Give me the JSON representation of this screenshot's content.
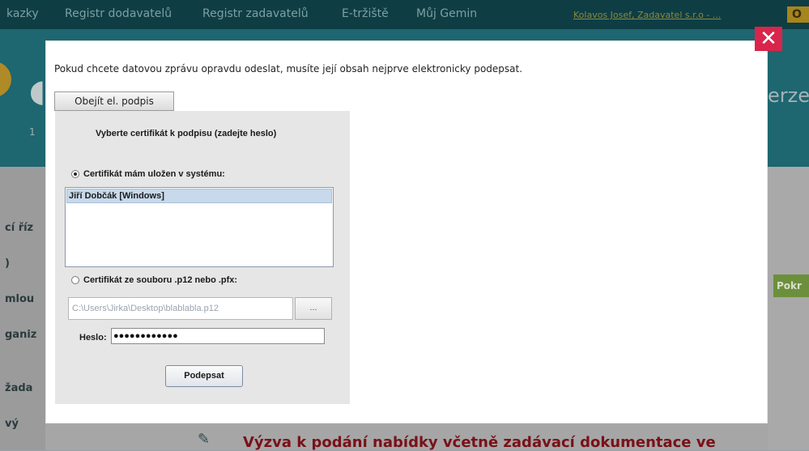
{
  "background": {
    "nav_items": [
      "kazky",
      "Registr dodavatelů",
      "Registr zadavatelů",
      "E-tržiště",
      "Můj Gemin"
    ],
    "user_link": "Kolavos Josef, Zadavatel s.r.o - ...",
    "nav_button": "O",
    "header_number": "1",
    "header_title_right": "erze",
    "left_menu": [
      "cí říz",
      ")",
      "mlou",
      "ganiz",
      "žada",
      "vý"
    ],
    "continue_button": "Pokr",
    "bottom_title": "Výzva k podání nabídky včetně zadávací dokumentace ve"
  },
  "modal": {
    "close_label": "✕",
    "message": "Pokud chcete datovou zprávu opravdu odeslat, musíte její obsah nejprve elektronicky podepsat.",
    "bypass_button": "Obejít el. podpis",
    "applet": {
      "title": "Vyberte certifikát k podpisu (zadejte heslo)",
      "option_system_label": "Certifikát mám uložen v systému:",
      "certificates": [
        "Jiří Dobčák [Windows]"
      ],
      "option_file_label": "Certifikát ze souboru .p12 nebo .pfx:",
      "file_path": "C:\\Users\\Jirka\\Desktop\\blablabla.p12",
      "browse_label": "...",
      "password_label": "Heslo:",
      "password_value": "●●●●●●●●●●●●",
      "sign_button": "Podepsat",
      "selected_option": "system"
    }
  }
}
